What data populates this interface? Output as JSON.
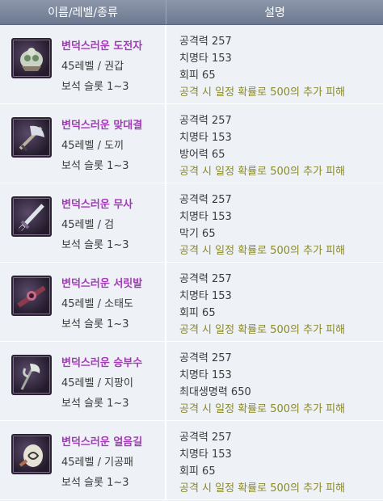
{
  "header": {
    "col1": "이름/레벨/종류",
    "col2": "설명"
  },
  "items": [
    {
      "name": "변덕스러운 도전자",
      "level_type": "45레벨 / 권갑",
      "slot": "보석 슬롯 1~3",
      "icon": "gauntlet-icon",
      "stats": [
        "공격력 257",
        "치명타 153",
        "회피 65"
      ],
      "effect": "공격 시 일정 확률로 500의 추가 피해"
    },
    {
      "name": "변덕스러운 맞대결",
      "level_type": "45레벨 / 도끼",
      "slot": "보석 슬롯 1~3",
      "icon": "axe-icon",
      "stats": [
        "공격력 257",
        "치명타 153",
        "방어력 65"
      ],
      "effect": "공격 시 일정 확률로 500의 추가 피해"
    },
    {
      "name": "변덕스러운 무사",
      "level_type": "45레벨 / 검",
      "slot": "보석 슬롯 1~3",
      "icon": "sword-icon",
      "stats": [
        "공격력 257",
        "치명타 153",
        "막기 65"
      ],
      "effect": "공격 시 일정 확률로 500의 추가 피해"
    },
    {
      "name": "변덕스러운 서릿발",
      "level_type": "45레벨 / 소태도",
      "slot": "보석 슬롯 1~3",
      "icon": "short-blade-icon",
      "stats": [
        "공격력 257",
        "치명타 153",
        "회피 65"
      ],
      "effect": "공격 시 일정 확률로 500의 추가 피해"
    },
    {
      "name": "변덕스러운 승부수",
      "level_type": "45레벨 / 지팡이",
      "slot": "보석 슬롯 1~3",
      "icon": "staff-icon",
      "stats": [
        "공격력 257",
        "치명타 153",
        "최대생명력 650"
      ],
      "effect": "공격 시 일정 확률로 500의 추가 피해"
    },
    {
      "name": "변덕스러운 얼음길",
      "level_type": "45레벨 / 기공패",
      "slot": "보석 슬롯 1~3",
      "icon": "talisman-icon",
      "stats": [
        "공격력 257",
        "치명타 153",
        "회피 65"
      ],
      "effect": "공격 시 일정 확률로 500의 추가 피해"
    }
  ]
}
